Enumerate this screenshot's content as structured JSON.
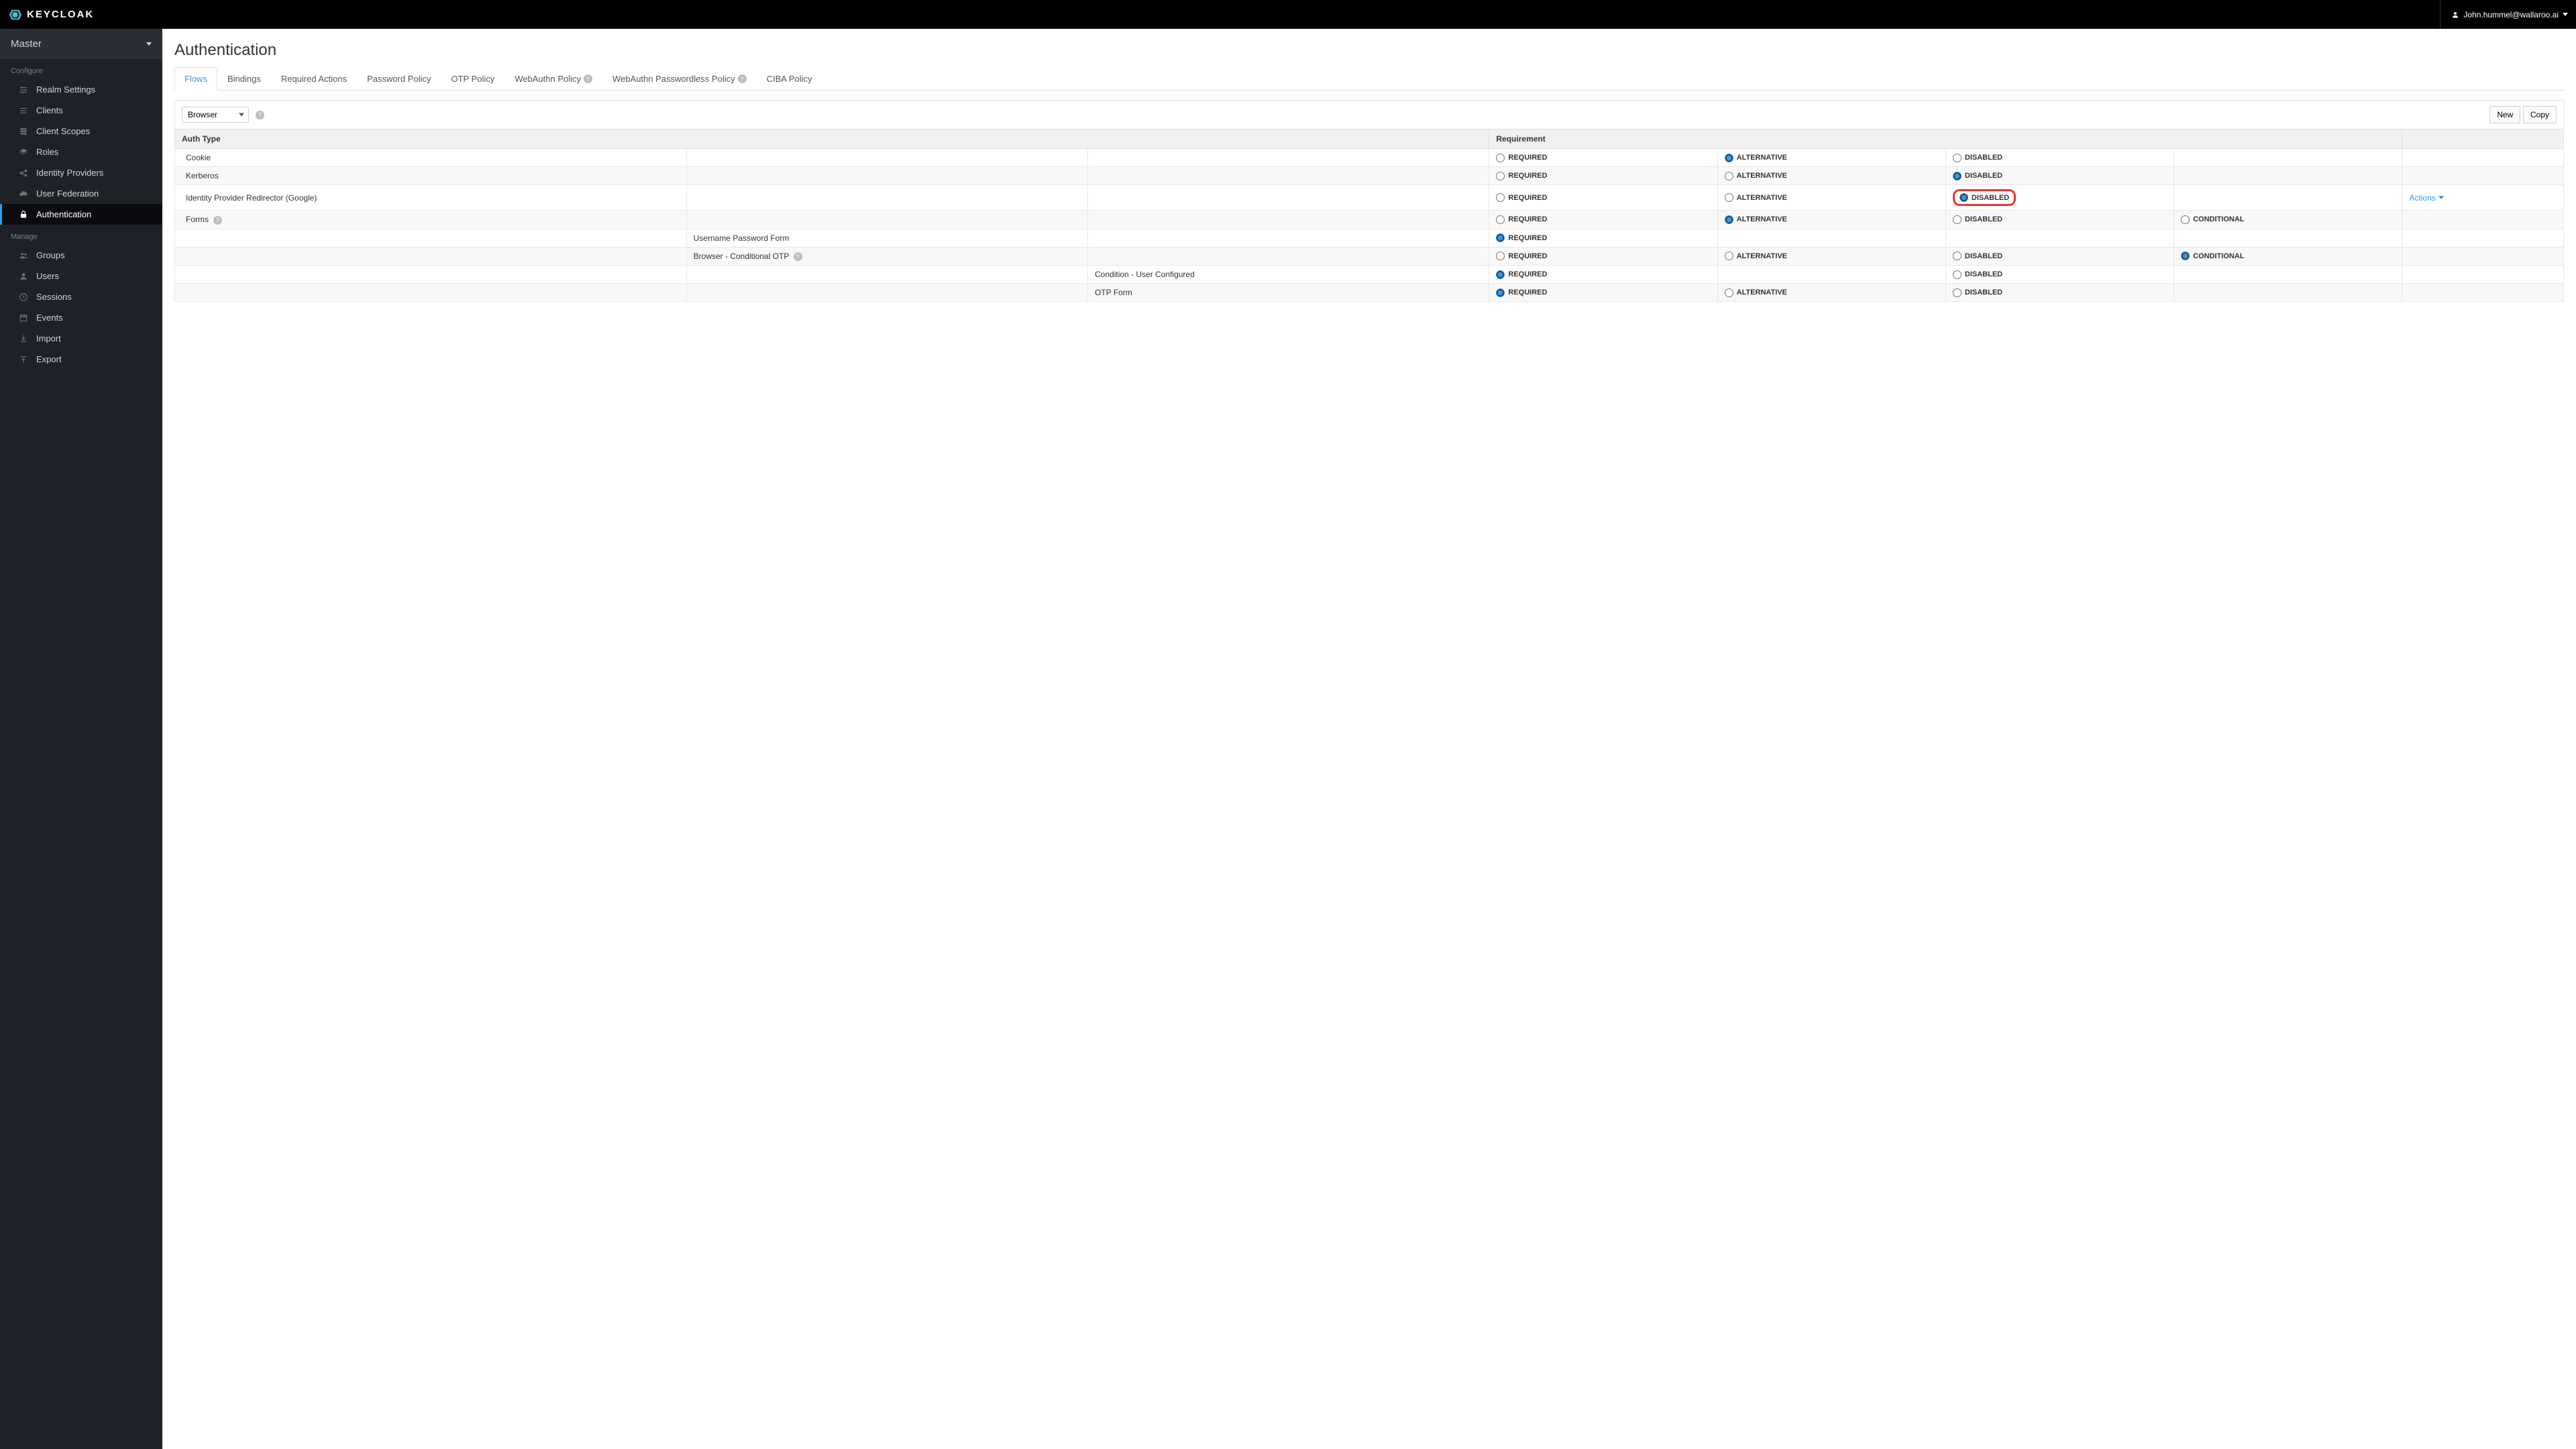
{
  "brand": {
    "name": "KEYCLOAK"
  },
  "user": {
    "email": "John.hummel@wallaroo.ai"
  },
  "realm": {
    "name": "Master"
  },
  "sidebar": {
    "sections": [
      {
        "label": "Configure",
        "items": [
          {
            "id": "realm-settings",
            "label": "Realm Settings",
            "icon": "sliders"
          },
          {
            "id": "clients",
            "label": "Clients",
            "icon": "list"
          },
          {
            "id": "client-scopes",
            "label": "Client Scopes",
            "icon": "stack"
          },
          {
            "id": "roles",
            "label": "Roles",
            "icon": "layers"
          },
          {
            "id": "identity-providers",
            "label": "Identity Providers",
            "icon": "share"
          },
          {
            "id": "user-federation",
            "label": "User Federation",
            "icon": "cloud"
          },
          {
            "id": "authentication",
            "label": "Authentication",
            "icon": "lock",
            "active": true
          }
        ]
      },
      {
        "label": "Manage",
        "items": [
          {
            "id": "groups",
            "label": "Groups",
            "icon": "users"
          },
          {
            "id": "users",
            "label": "Users",
            "icon": "user"
          },
          {
            "id": "sessions",
            "label": "Sessions",
            "icon": "clock"
          },
          {
            "id": "events",
            "label": "Events",
            "icon": "calendar"
          },
          {
            "id": "import",
            "label": "Import",
            "icon": "import"
          },
          {
            "id": "export",
            "label": "Export",
            "icon": "export"
          }
        ]
      }
    ]
  },
  "page": {
    "title": "Authentication"
  },
  "tabs": [
    {
      "id": "flows",
      "label": "Flows",
      "active": true
    },
    {
      "id": "bindings",
      "label": "Bindings"
    },
    {
      "id": "required-actions",
      "label": "Required Actions"
    },
    {
      "id": "password-policy",
      "label": "Password Policy"
    },
    {
      "id": "otp-policy",
      "label": "OTP Policy"
    },
    {
      "id": "webauthn-policy",
      "label": "WebAuthn Policy",
      "help": true
    },
    {
      "id": "webauthn-passwordless",
      "label": "WebAuthn Passwordless Policy",
      "help": true
    },
    {
      "id": "ciba-policy",
      "label": "CIBA Policy"
    }
  ],
  "toolbar": {
    "flow_selected": "Browser",
    "new_label": "New",
    "copy_label": "Copy"
  },
  "table": {
    "headers": {
      "auth_type": "Auth Type",
      "requirement": "Requirement"
    },
    "labels": {
      "required": "REQUIRED",
      "alternative": "ALTERNATIVE",
      "disabled": "DISABLED",
      "conditional": "CONDITIONAL",
      "actions": "Actions"
    },
    "rows": [
      {
        "indent": 0,
        "name": "Cookie",
        "help": false,
        "options": [
          "required",
          "alternative",
          "disabled"
        ],
        "selected": "alternative",
        "actions": false,
        "highlight": false
      },
      {
        "indent": 0,
        "name": "Kerberos",
        "help": false,
        "options": [
          "required",
          "alternative",
          "disabled"
        ],
        "selected": "disabled",
        "actions": false,
        "highlight": false
      },
      {
        "indent": 0,
        "name": "Identity Provider Redirector   (Google)",
        "help": false,
        "options": [
          "required",
          "alternative",
          "disabled"
        ],
        "selected": "disabled",
        "actions": true,
        "highlight": true
      },
      {
        "indent": 0,
        "name": "Forms",
        "help": true,
        "options": [
          "required",
          "alternative",
          "disabled",
          "conditional"
        ],
        "selected": "alternative",
        "actions": false,
        "highlight": false
      },
      {
        "indent": 1,
        "name": "Username Password Form",
        "help": false,
        "options": [
          "required"
        ],
        "selected": "required",
        "actions": false,
        "highlight": false
      },
      {
        "indent": 1,
        "name": "Browser - Conditional OTP",
        "help": true,
        "options": [
          "required",
          "alternative",
          "disabled",
          "conditional"
        ],
        "selected": "conditional",
        "actions": false,
        "highlight": false
      },
      {
        "indent": 2,
        "name": "Condition - User Configured",
        "help": false,
        "options": [
          "required",
          "disabled"
        ],
        "selected": "required",
        "actions": false,
        "highlight": false
      },
      {
        "indent": 2,
        "name": "OTP Form",
        "help": false,
        "options": [
          "required",
          "alternative",
          "disabled"
        ],
        "selected": "required",
        "actions": false,
        "highlight": false
      }
    ]
  }
}
